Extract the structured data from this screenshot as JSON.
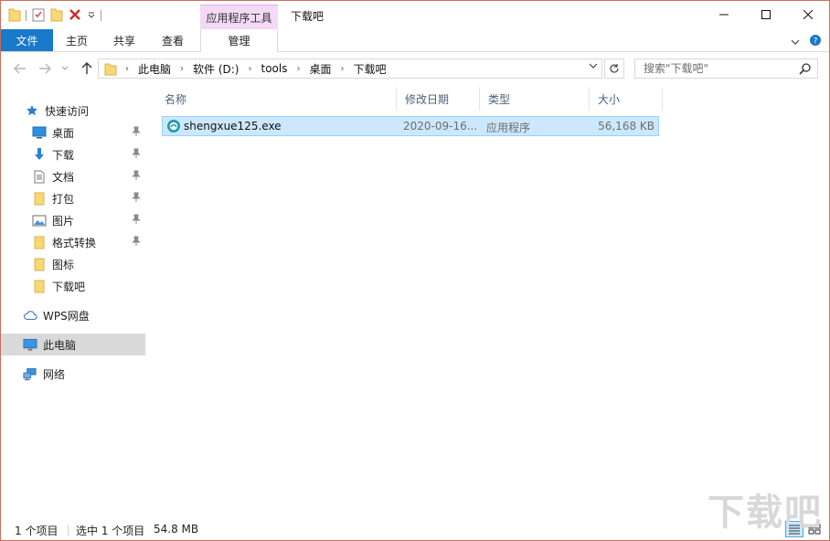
{
  "window": {
    "title": "下载吧",
    "context_tab_group": "应用程序工具"
  },
  "ribbon": {
    "tabs": [
      {
        "label": "文件"
      },
      {
        "label": "主页"
      },
      {
        "label": "共享"
      },
      {
        "label": "查看"
      },
      {
        "label": "管理"
      }
    ]
  },
  "address": {
    "crumbs": [
      "此电脑",
      "软件 (D:)",
      "tools",
      "桌面",
      "下载吧"
    ]
  },
  "search": {
    "placeholder": "搜索\"下载吧\""
  },
  "sidebar": {
    "quick_access": "快速访问",
    "items": [
      {
        "label": "桌面"
      },
      {
        "label": "下载"
      },
      {
        "label": "文档"
      },
      {
        "label": "打包"
      },
      {
        "label": "图片"
      },
      {
        "label": "格式转换"
      },
      {
        "label": "图标"
      },
      {
        "label": "下载吧"
      }
    ],
    "wps": "WPS网盘",
    "this_pc": "此电脑",
    "network": "网络"
  },
  "columns": {
    "name": "名称",
    "date": "修改日期",
    "type": "类型",
    "size": "大小"
  },
  "files": [
    {
      "name": "shengxue125.exe",
      "date": "2020-09-16...",
      "type": "应用程序",
      "size": "56,168 KB"
    }
  ],
  "status": {
    "count": "1 个项目",
    "selected": "选中 1 个项目",
    "selected_size": "54.8 MB"
  },
  "watermark": "下载吧",
  "colors": {
    "accent": "#1979ca",
    "selection": "#cce8ff",
    "context_tab": "#f3d9f5"
  }
}
